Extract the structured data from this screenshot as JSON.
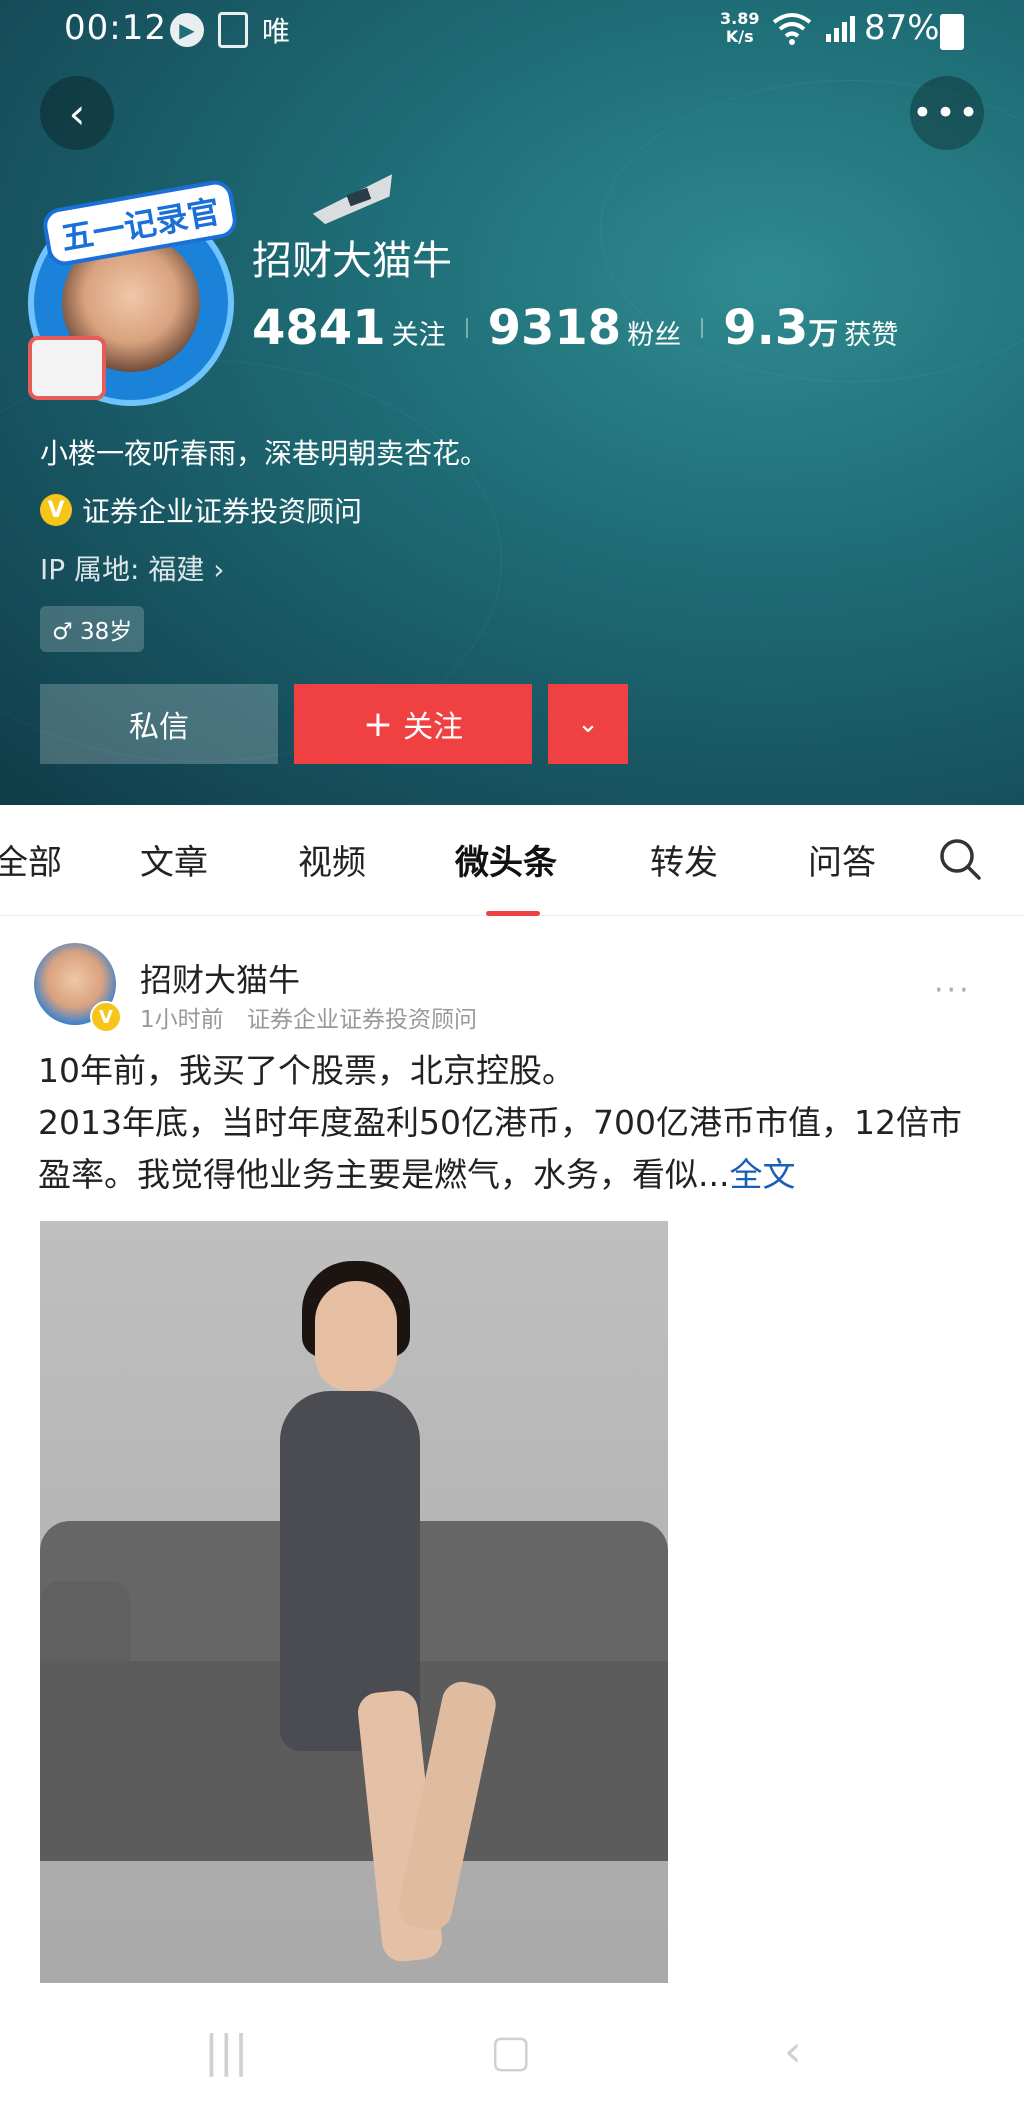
{
  "status_bar": {
    "time": "00:12",
    "app_indicator": "唯",
    "speed_value": "3.89",
    "speed_unit": "K/s",
    "battery": "87%"
  },
  "profile": {
    "avatar_banner": "五一记录官",
    "name": "招财大猫牛",
    "stats": {
      "following_num": "4841",
      "following_label": "关注",
      "fans_num": "9318",
      "fans_label": "粉丝",
      "likes_num": "9.3",
      "likes_unit": "万",
      "likes_label": "获赞"
    },
    "bio": "小楼一夜听春雨，深巷明朝卖杏花。",
    "verification": "证券企业证券投资顾问",
    "ip_location": "IP 属地: 福建",
    "age": "38岁",
    "buttons": {
      "message": "私信",
      "follow": "关注"
    }
  },
  "tabs": [
    "全部",
    "文章",
    "视频",
    "微头条",
    "转发",
    "问答"
  ],
  "active_tab": "微头条",
  "post": {
    "author": "招财大猫牛",
    "time": "1小时前",
    "author_title": "证券企业证券投资顾问",
    "text_line1": "10年前，我买了个股票，北京控股。",
    "text_line2": "2013年底，当时年度盈利50亿港币，700亿港币市值，12倍市盈率。我觉得他业务主要是燃气，水务，看似...",
    "read_more": "全文"
  },
  "icons": {
    "back": "chevron-left-icon",
    "more": "more-dots-icon",
    "search": "search-icon",
    "dropdown": "chevron-down-icon",
    "verified": "verified-v-icon",
    "gender": "male-icon"
  },
  "colors": {
    "accent_red": "#f04142",
    "header_teal": "#1f6f78",
    "link_blue": "#1a5fb4",
    "verify_gold": "#f5c518"
  }
}
